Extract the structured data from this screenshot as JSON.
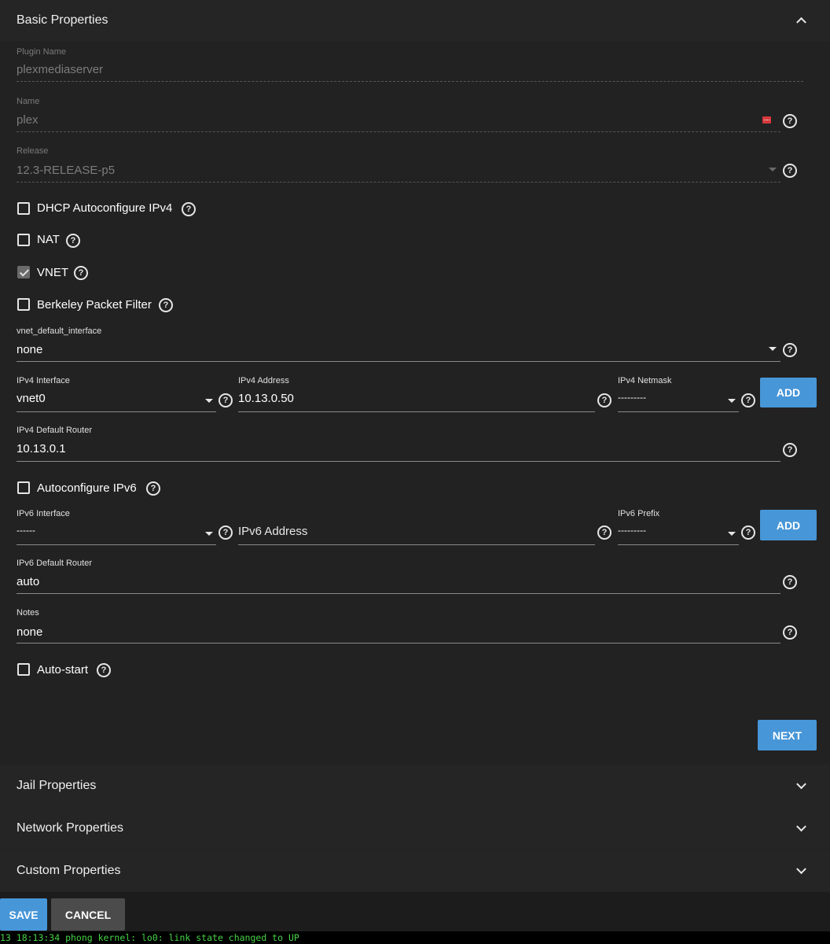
{
  "sections": {
    "basic": "Basic Properties",
    "jail": "Jail Properties",
    "network": "Network Properties",
    "custom": "Custom Properties"
  },
  "fields": {
    "plugin_name": {
      "label": "Plugin Name",
      "value": "plexmediaserver"
    },
    "name": {
      "label": "Name",
      "value": "plex"
    },
    "release": {
      "label": "Release",
      "value": "12.3-RELEASE-p5"
    },
    "vnet_default_interface": {
      "label": "vnet_default_interface",
      "value": "none"
    },
    "ipv4_interface": {
      "label": "IPv4 Interface",
      "value": "vnet0"
    },
    "ipv4_address": {
      "label": "IPv4 Address",
      "value": "10.13.0.50"
    },
    "ipv4_netmask": {
      "label": "IPv4 Netmask",
      "value": "---------"
    },
    "ipv4_default_router": {
      "label": "IPv4 Default Router",
      "value": "10.13.0.1"
    },
    "ipv6_interface": {
      "label": "IPv6 Interface",
      "value": "------"
    },
    "ipv6_address": {
      "placeholder": "IPv6 Address"
    },
    "ipv6_prefix": {
      "label": "IPv6 Prefix",
      "value": "---------"
    },
    "ipv6_default_router": {
      "label": "IPv6 Default Router",
      "value": "auto"
    },
    "notes": {
      "label": "Notes",
      "value": "none"
    }
  },
  "checkboxes": {
    "dhcp": {
      "label": "DHCP Autoconfigure IPv4",
      "checked": false
    },
    "nat": {
      "label": "NAT",
      "checked": false
    },
    "vnet": {
      "label": "VNET",
      "checked": true
    },
    "bpf": {
      "label": "Berkeley Packet Filter",
      "checked": false
    },
    "autoconf_ipv6": {
      "label": "Autoconfigure IPv6",
      "checked": false
    },
    "autostart": {
      "label": "Auto-start",
      "checked": false
    }
  },
  "buttons": {
    "add": "ADD",
    "next": "NEXT",
    "save": "SAVE",
    "cancel": "CANCEL"
  },
  "help_glyph": "?",
  "console_line": "13 18:13:34 phong kernel: lo0: link state changed to UP",
  "colors": {
    "accent": "#4796d8",
    "background": "#222222",
    "panel": "#252525",
    "console_text": "#46d346"
  }
}
